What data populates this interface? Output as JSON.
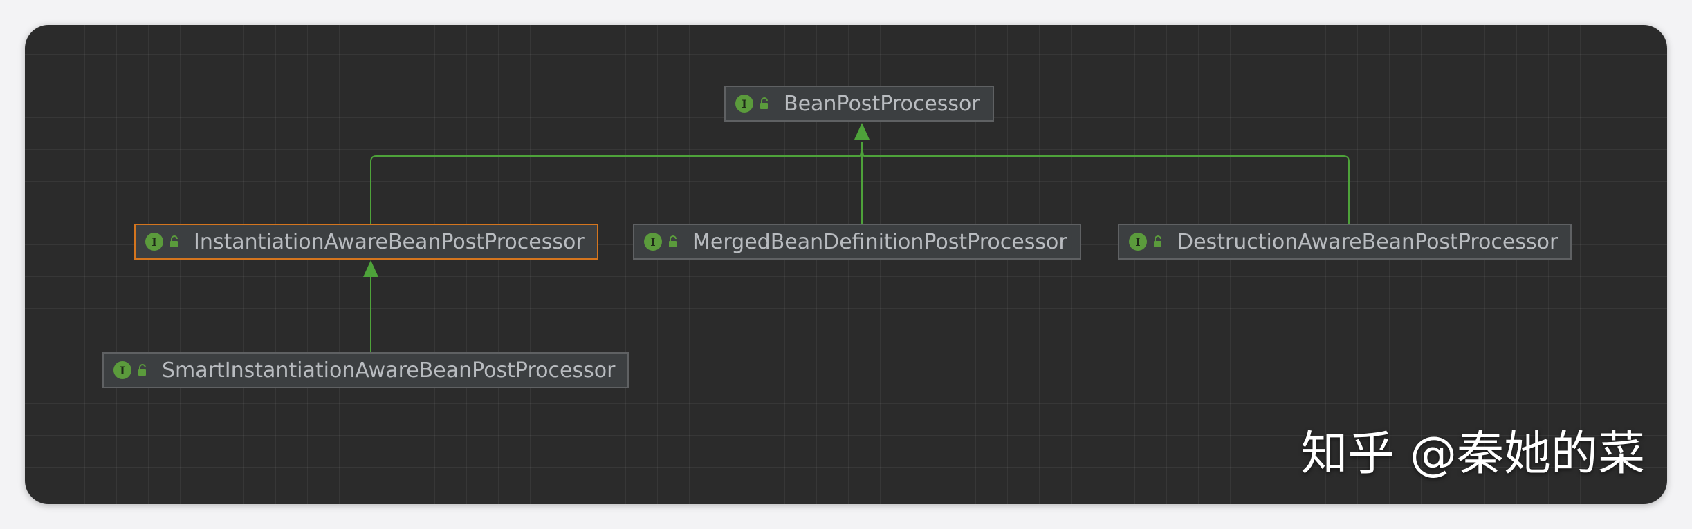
{
  "diagram": {
    "nodes": [
      {
        "id": "bean-post-processor",
        "label": "BeanPostProcessor",
        "icon": "interface-icon",
        "selected": false
      },
      {
        "id": "instantiation-aware",
        "label": "InstantiationAwareBeanPostProcessor",
        "icon": "interface-icon",
        "selected": true
      },
      {
        "id": "merged-bean-definition",
        "label": "MergedBeanDefinitionPostProcessor",
        "icon": "interface-icon",
        "selected": false
      },
      {
        "id": "destruction-aware",
        "label": "DestructionAwareBeanPostProcessor",
        "icon": "interface-icon",
        "selected": false
      },
      {
        "id": "smart-instantiation-aware",
        "label": "SmartInstantiationAwareBeanPostProcessor",
        "icon": "interface-icon",
        "selected": false
      }
    ],
    "edges": [
      {
        "from": "instantiation-aware",
        "to": "bean-post-processor",
        "type": "extends"
      },
      {
        "from": "merged-bean-definition",
        "to": "bean-post-processor",
        "type": "extends"
      },
      {
        "from": "destruction-aware",
        "to": "bean-post-processor",
        "type": "extends"
      },
      {
        "from": "smart-instantiation-aware",
        "to": "instantiation-aware",
        "type": "extends"
      }
    ],
    "interface_icon_letter": "I",
    "colors": {
      "background": "#2b2b2b",
      "node_fill": "#3c3f41",
      "node_border": "#5f6163",
      "selected_border": "#d4751e",
      "edge": "#4ea23a",
      "icon": "#5b9b3c",
      "label": "#b9bcc0"
    }
  },
  "watermark": "知乎 @秦她的菜"
}
